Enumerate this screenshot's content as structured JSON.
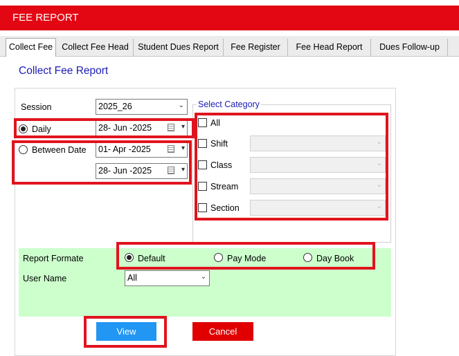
{
  "window": {
    "title": "FEE REPORT"
  },
  "tabs": [
    {
      "label": "Collect Fee",
      "active": true
    },
    {
      "label": "Collect Fee Head",
      "active": false
    },
    {
      "label": "Student Dues Report",
      "active": false
    },
    {
      "label": "Fee Register",
      "active": false
    },
    {
      "label": "Fee Head Report",
      "active": false
    },
    {
      "label": "Dues Follow-up",
      "active": false
    }
  ],
  "page": {
    "title": "Collect Fee Report"
  },
  "form": {
    "session_label": "Session",
    "session_value": "2025_26",
    "daily_label": "Daily",
    "daily_date": "28- Jun -2025",
    "between_label": "Between Date",
    "from_date": "01- Apr -2025",
    "to_date": "28- Jun -2025",
    "selected_mode": "Daily"
  },
  "category": {
    "legend": "Select Category",
    "all_label": "All",
    "items": [
      {
        "label": "Shift",
        "value": ""
      },
      {
        "label": "Class",
        "value": ""
      },
      {
        "label": "Stream",
        "value": ""
      },
      {
        "label": "Section",
        "value": ""
      }
    ]
  },
  "report": {
    "format_label": "Report Formate",
    "options": [
      "Default",
      "Pay Mode",
      "Day Book"
    ],
    "selected": "Default",
    "user_label": "User Name",
    "user_value": "All"
  },
  "buttons": {
    "view": "View",
    "cancel": "Cancel"
  },
  "colors": {
    "title_bar": "#e30613",
    "heading_blue": "#1a1ab8",
    "view_button": "#2196f3",
    "cancel_button": "#e00000",
    "report_panel": "#ccffcc",
    "highlight_box": "#e0141e"
  },
  "icons": {
    "calendar": "calendar-icon",
    "dropdown": "chevron-down-icon"
  }
}
